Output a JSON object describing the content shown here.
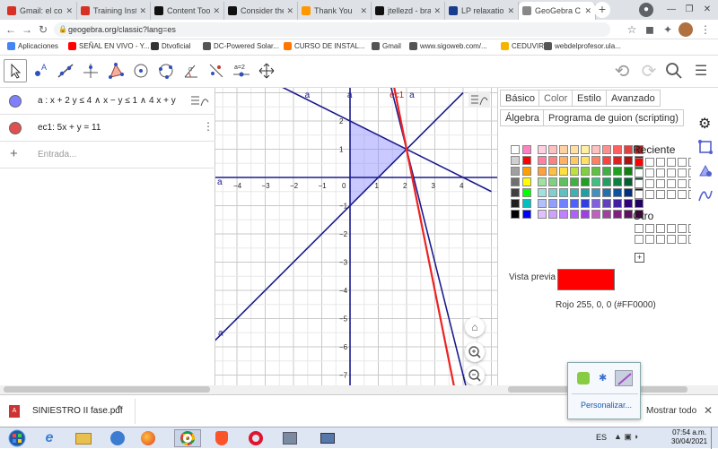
{
  "browser": {
    "tabs": [
      {
        "title": "Gmail: el co",
        "icon_color": "#d93025",
        "icon_letter": "M"
      },
      {
        "title": "Training Inst",
        "icon_color": "#d93025",
        "icon_letter": "M"
      },
      {
        "title": "Content Too",
        "icon_color": "#111111",
        "icon_letter": "b"
      },
      {
        "title": "Consider the",
        "icon_color": "#111111",
        "icon_letter": "b"
      },
      {
        "title": "Thank You",
        "icon_color": "#ff9800",
        "icon_letter": "/"
      },
      {
        "title": "jtellezd - bra",
        "icon_color": "#111111",
        "icon_letter": "b"
      },
      {
        "title": "LP relaxatio",
        "icon_color": "#1a3c8f",
        "icon_letter": "BU"
      },
      {
        "title": "GeoGebra C",
        "icon_color": "#888888",
        "icon_letter": ""
      }
    ],
    "active_tab_index": 7,
    "url": "geogebra.org/classic?lang=es",
    "bookmarks": [
      {
        "label": "Aplicaciones",
        "color": "#4285f4"
      },
      {
        "label": "SEÑAL EN VIVO - Y...",
        "color": "#ff0000"
      },
      {
        "label": "Dtvoficial",
        "color": "#333333"
      },
      {
        "label": "DC-Powered Solar...",
        "color": "#555555"
      },
      {
        "label": "CURSO DE INSTAL...",
        "color": "#ff7700"
      },
      {
        "label": "Gmail",
        "color": "#555555"
      },
      {
        "label": "www.sigoweb.com/...",
        "color": "#555555"
      },
      {
        "label": "CEDUVIRT",
        "color": "#f4b400"
      },
      {
        "label": "webdelprofesor.ula...",
        "color": "#555555"
      }
    ]
  },
  "algebra": {
    "rows": [
      {
        "text": "a : x + 2 y ≤ 4 ∧ x − y ≤ 1 ∧ 4 x + y",
        "dot_color": "#8080ff"
      },
      {
        "text": "ec1: 5x + y = 11",
        "dot_color": "#e05050"
      }
    ],
    "input_placeholder": "Entrada..."
  },
  "graphics": {
    "x_ticks": [
      "−4",
      "−3",
      "−2",
      "−1",
      "0",
      "1",
      "2",
      "3",
      "4"
    ],
    "y_ticks": [
      "2",
      "1",
      "−1",
      "−2",
      "−3",
      "−4",
      "−5",
      "−6",
      "−7"
    ],
    "labels": {
      "a": "a",
      "ec1": "ec1"
    },
    "region_color": "#8888ff",
    "line_color": "#1a1a8c",
    "red_line_color": "#ee2222"
  },
  "properties": {
    "tabs_row1": [
      "Básico",
      "Color",
      "Estilo",
      "Avanzado"
    ],
    "tabs_row2": [
      "Álgebra",
      "Programa de guion (scripting)"
    ],
    "active_tab": "Color",
    "recent_label": "Reciente",
    "other_label": "Otro",
    "preview_label": "Vista previa",
    "preview_color": "#ff0000",
    "color_value": "Rojo 255, 0, 0 (#FF0000)"
  },
  "download": {
    "file": "SINIESTRO II fase.pdf",
    "show_all": "Mostrar todo"
  },
  "tray_popup": {
    "label": "Personalizar..."
  },
  "taskbar": {
    "lang": "ES",
    "time": "07:54 a.m.",
    "date": "30/04/2021"
  }
}
